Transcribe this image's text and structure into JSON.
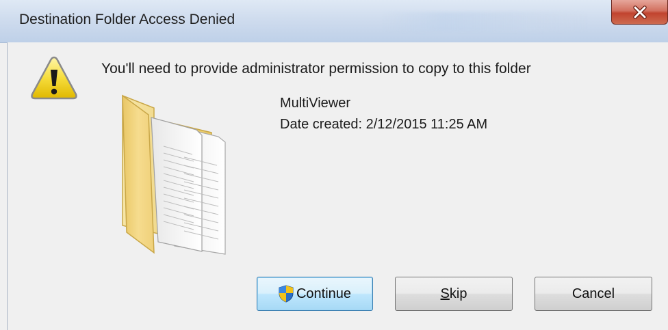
{
  "window": {
    "title": "Destination Folder Access Denied",
    "close_icon": "close-icon"
  },
  "dialog": {
    "message": "You'll need to provide administrator permission to copy to this folder",
    "warning_icon": "warning-icon",
    "folder_icon": "folder-icon",
    "item": {
      "name": "MultiViewer",
      "date_created": "Date created: 2/12/2015 11:25 AM"
    }
  },
  "buttons": {
    "continue_label": "Continue",
    "skip_label": "Skip",
    "skip_mnemonic": "S",
    "skip_rest": "kip",
    "cancel_label": "Cancel",
    "shield_icon": "uac-shield-icon"
  },
  "colors": {
    "close_button": "#c1442f",
    "default_button_border": "#3c7fb1",
    "folder_yellow": "#f3d78a"
  }
}
